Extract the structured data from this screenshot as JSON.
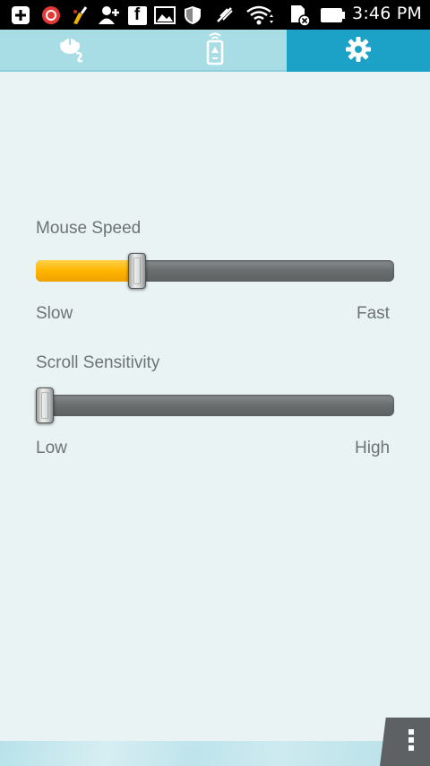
{
  "status_bar": {
    "time": "3:46 PM",
    "icons": [
      "add-box-icon",
      "app-notification-icon",
      "cleaner-icon",
      "add-contact-icon",
      "facebook-icon",
      "gallery-icon",
      "shield-icon",
      "mute-icon",
      "wifi-icon",
      "sd-card-icon",
      "battery-icon"
    ],
    "facebook_glyph": "f"
  },
  "tabs": [
    {
      "name": "mouse",
      "icon": "mouse-icon",
      "selected": false
    },
    {
      "name": "remote",
      "icon": "remote-phone-icon",
      "selected": false
    },
    {
      "name": "settings",
      "icon": "gear-icon",
      "selected": true
    }
  ],
  "settings": {
    "mouse_speed": {
      "label": "Mouse Speed",
      "min_label": "Slow",
      "max_label": "Fast",
      "value_fraction": 0.27
    },
    "scroll_sensitivity": {
      "label": "Scroll Sensitivity",
      "min_label": "Low",
      "max_label": "High",
      "value_fraction": 0.0
    }
  },
  "colors": {
    "accent_selected_tab": "#1ba2c6",
    "tab_bg": "#a9dde5",
    "slider_fill": "#ffb400",
    "background": "#e9f3f4"
  },
  "menu": {
    "icon": "overflow-menu-icon"
  }
}
